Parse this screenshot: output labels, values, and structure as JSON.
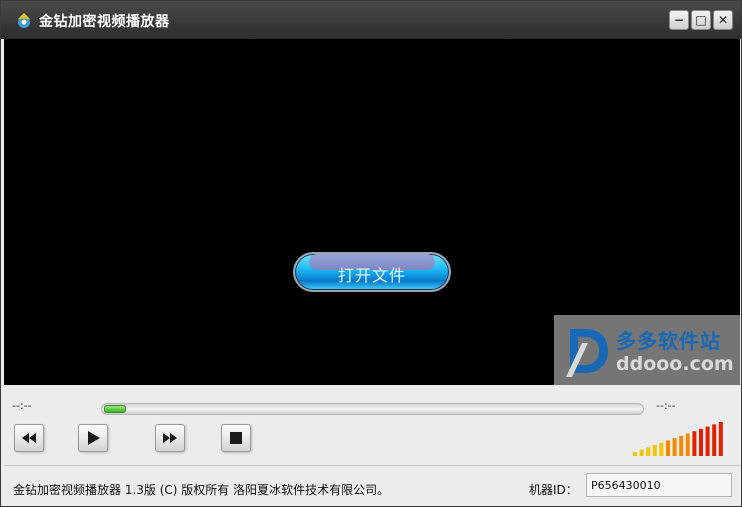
{
  "window": {
    "title": "金钻加密视频播放器",
    "controls": {
      "minimize": "−",
      "maximize": "□",
      "close": "✕"
    }
  },
  "video": {
    "open_file_label": "打开文件",
    "watermark": {
      "cn": "多多软件站",
      "en": "ddooo.com",
      "logo_letter": "D"
    }
  },
  "playback": {
    "elapsed": "--:--",
    "remaining": "--:--",
    "progress": 0.0,
    "buttons": [
      "rewind-icon",
      "play-icon",
      "fast-forward-icon",
      "stop-icon"
    ]
  },
  "volume": {
    "bars": 14,
    "level": 1.0,
    "colors": [
      "#f5c400",
      "#f08a00",
      "#e02000"
    ]
  },
  "status": {
    "copyright": "金钻加密视频播放器 1.3版 (C) 版权所有 洛阳夏冰软件技术有限公司。",
    "machine_id_label": "机器ID：",
    "machine_id": "P656430010"
  }
}
